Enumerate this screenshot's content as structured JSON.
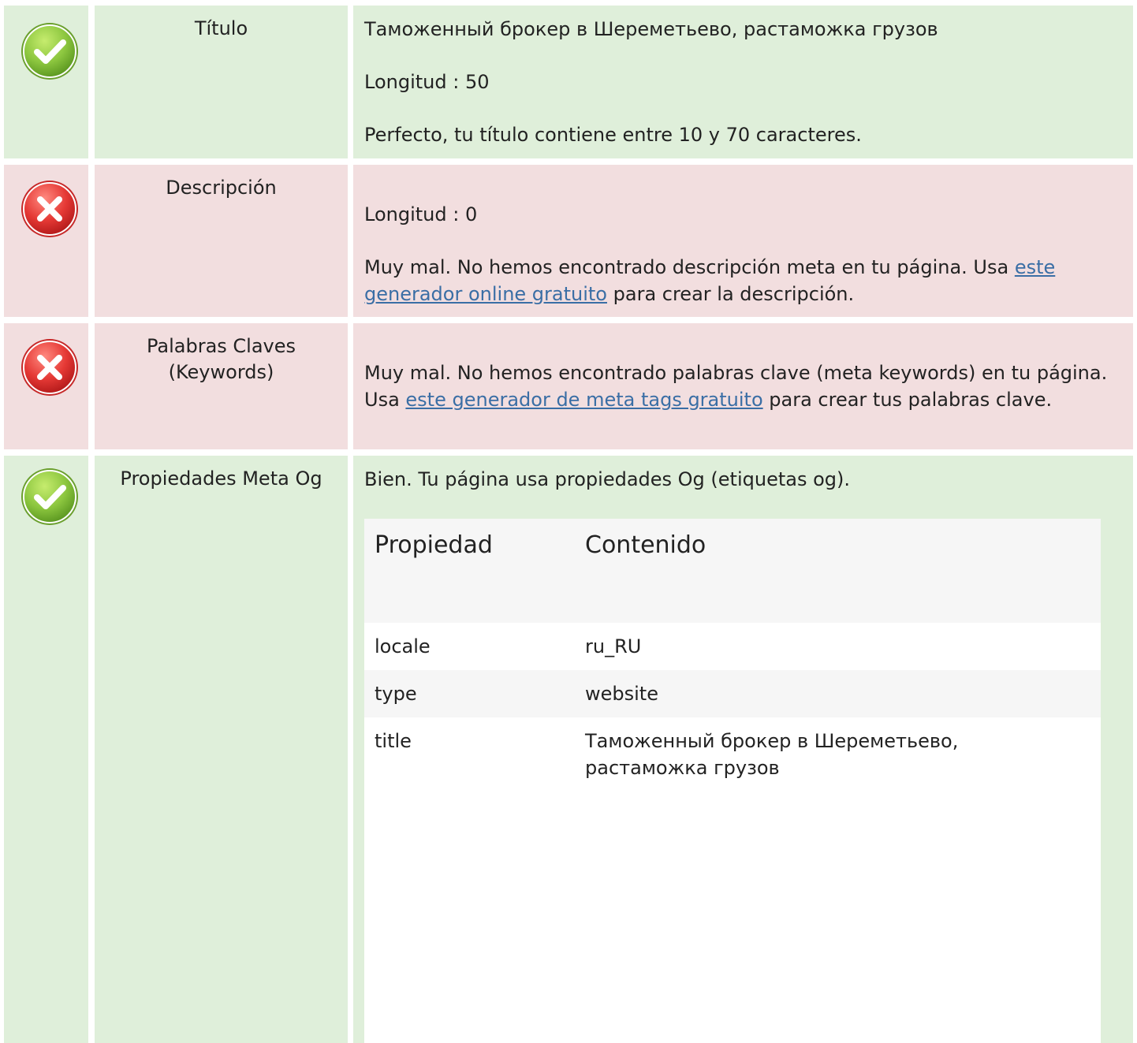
{
  "colors": {
    "pass_bg": "#dfefda",
    "fail_bg": "#f2dedf",
    "pass_icon": "#8cc63f",
    "fail_icon": "#e53935",
    "link": "#3a6ea5"
  },
  "rows": {
    "titulo": {
      "status_icon": "check-icon",
      "label": "Título",
      "value": "Таможенный брокер в Шереметьево, растаможка грузов",
      "length": "Longitud : 50",
      "message": "Perfecto, tu título contiene entre 10 y 70 caracteres."
    },
    "descripcion": {
      "status_icon": "cross-icon",
      "label": "Descripción",
      "length": "Longitud : 0",
      "message_before": "Muy mal. No hemos encontrado descripción meta en tu página. Usa ",
      "link_text": "este generador online gratuito",
      "message_after": " para crear la descripción."
    },
    "keywords": {
      "status_icon": "cross-icon",
      "label_line1": "Palabras Claves",
      "label_line2": "(Keywords)",
      "message_before": "Muy mal. No hemos encontrado palabras clave (meta keywords) en tu página. Usa ",
      "link_text": "este generador de meta tags gratuito",
      "message_after": " para crear tus palabras clave."
    },
    "og": {
      "status_icon": "check-icon",
      "label": "Propiedades Meta Og",
      "message": "Bien. Tu página usa propiedades Og (etiquetas og).",
      "table": {
        "headers": [
          "Propiedad",
          "Contenido"
        ],
        "rows": [
          {
            "property": "locale",
            "content": "ru_RU"
          },
          {
            "property": "type",
            "content": "website"
          },
          {
            "property": "title",
            "content": "Таможенный брокер в Шереметьево, растаможка грузов"
          }
        ]
      }
    }
  }
}
